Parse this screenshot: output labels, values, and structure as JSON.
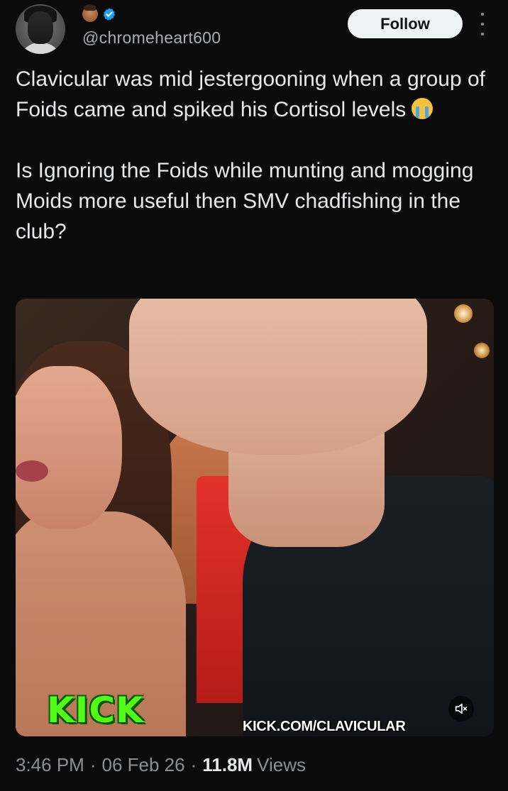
{
  "author": {
    "handle": "@chromeheart600",
    "badge_emoji": "person-emoji-icon",
    "verified_icon": "verified-badge-icon",
    "verified_color": "#1d9bf0"
  },
  "follow_button": {
    "label": "Follow"
  },
  "tweet": {
    "paragraph1": "Clavicular was mid jestergooning when a group of Foids came and spiked his Cortisol levels",
    "paragraph1_emoji": "loudly-crying-face-emoji",
    "paragraph2": "Is Ignoring the Foids while munting and mogging Moids more useful then SMV chadfishing in the club?"
  },
  "media": {
    "watermark_logo": "KICK",
    "watermark_url": "KICK.COM/CLAVICULAR",
    "logo_color": "#53fc18",
    "mute_icon": "muted-speaker-icon"
  },
  "meta": {
    "time": "3:46 PM",
    "date": "06 Feb 26",
    "views_count": "11.8M",
    "views_label": "Views",
    "separator": "·"
  }
}
